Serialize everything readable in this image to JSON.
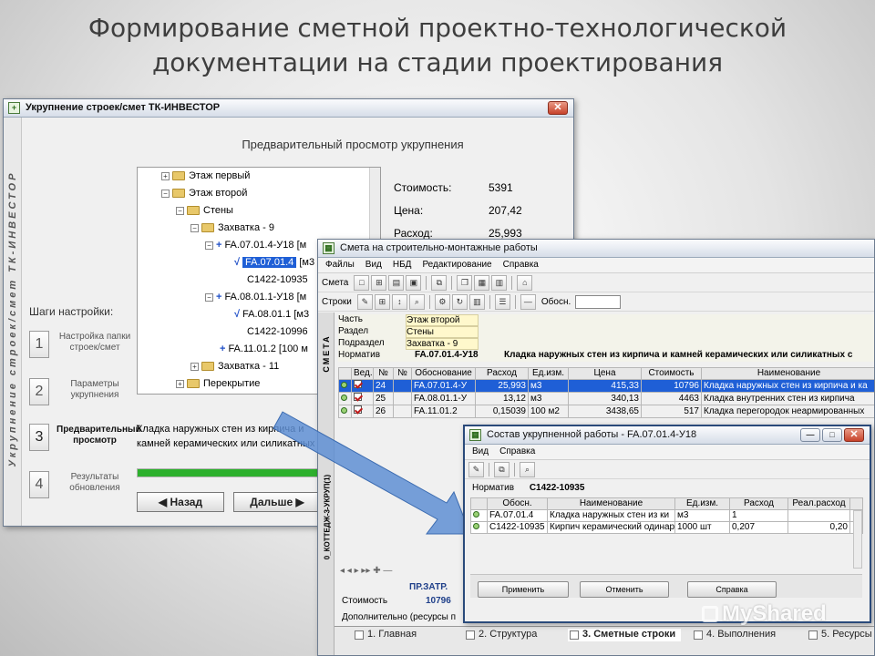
{
  "slide": {
    "title_line1": "Формирование сметной проектно-технологической",
    "title_line2": "документации на стадии проектирования"
  },
  "win1": {
    "title": "Укрупнение строек/смет ТК-ИНВЕСТОР",
    "side_label": "Укрупнение строек/смет ТК-ИНВЕСТОР",
    "header": "Предварительный просмотр укрупнения",
    "tree": [
      {
        "label": "Этаж первый"
      },
      {
        "label": "Этаж второй"
      },
      {
        "label": "Стены"
      },
      {
        "label": "Захватка - 9"
      },
      {
        "label": "FA.07.01.4-У18",
        "suffix": "[м"
      },
      {
        "label": "FA.07.01.4",
        "suffix": "[м3"
      },
      {
        "label": "С1422-10935"
      },
      {
        "label": "FA.08.01.1-У18",
        "suffix": "[м"
      },
      {
        "label": "FA.08.01.1",
        "suffix": "[м3"
      },
      {
        "label": "С1422-10996"
      },
      {
        "label": "FA.11.01.2",
        "suffix": "[100 м"
      },
      {
        "label": "Захватка - 11"
      },
      {
        "label": "Перекрытие"
      }
    ],
    "stats": [
      {
        "label": "Стоимость:",
        "value": "5391"
      },
      {
        "label": "Цена:",
        "value": "207,42"
      },
      {
        "label": "Расход:",
        "value": "25,993"
      }
    ],
    "steps_title": "Шаги настройки:",
    "steps": [
      {
        "num": "1",
        "label": "Настройка папки строек/смет"
      },
      {
        "num": "2",
        "label": "Параметры укрупнения"
      },
      {
        "num": "3",
        "label": "Предварительный просмотр"
      },
      {
        "num": "4",
        "label": "Результаты обновления"
      }
    ],
    "description": "Кладка наружных стен из кирпича и камней керамических или силикатных с лицевым кирпичом, камнями керамическими",
    "progress": 1.0,
    "back_button": "◀  Назад",
    "next_button": "Дальше  ▶"
  },
  "win2": {
    "title": "Смета на строительно-монтажные работы",
    "menu": [
      "Файлы",
      "Вид",
      "НБД",
      "Редактирование",
      "Справка"
    ],
    "toolbar1_label": "Смета",
    "toolbar2_label": "Строки",
    "obosn_label": "Обосн.",
    "side_label": "СМЕТА",
    "side_label2": "0_КОТТЕДЖ-3-УКРУП(1)",
    "info": [
      {
        "label": "Часть",
        "value": "Этаж второй"
      },
      {
        "label": "Раздел",
        "value": "Стены"
      },
      {
        "label": "Подраздел",
        "value": "Захватка - 9"
      }
    ],
    "normativ_label": "Норматив",
    "normativ_code": "FA.07.01.4-У18",
    "normativ_name": "Кладка наружных стен из кирпича и камней керамических или силикатных с",
    "columns": [
      "Вед.",
      "№",
      "№",
      "Обоснование",
      "Расход",
      "Ед.изм.",
      "Цена",
      "Стоимость",
      "Наименование"
    ],
    "rows": [
      {
        "n": "24",
        "code": "FA.07.01.4-У",
        "qty": "25,993",
        "unit": "м3",
        "price": "415,33",
        "cost": "10796",
        "name": "Кладка наружных стен из кирпича и ка"
      },
      {
        "n": "25",
        "code": "FA.08.01.1-У",
        "qty": "13,12",
        "unit": "м3",
        "price": "340,13",
        "cost": "4463",
        "name": "Кладка внутренних стен из кирпича"
      },
      {
        "n": "26",
        "code": "FA.11.01.2",
        "qty": "0,15039",
        "unit": "100 м2",
        "price": "3438,65",
        "cost": "517",
        "name": "Кладка перегородок неармированных"
      }
    ],
    "bottom_header": "ПР.ЗАТР.",
    "cost_label": "Стоимость",
    "cost_value": "10796",
    "extra": "Дополнительно (ресурсы п",
    "tabs": [
      "1. Главная",
      "2. Структура",
      "3. Сметные строки",
      "4. Выполнения",
      "5. Ресурсы"
    ]
  },
  "win3": {
    "title": "Состав укрупненной работы - FA.07.01.4-У18",
    "menu": [
      "Вид",
      "Справка"
    ],
    "normativ_label": "Норматив",
    "normativ_value": "С1422-10935",
    "columns": [
      "Обосн.",
      "Наименование",
      "Ед.изм.",
      "Расход",
      "Реал.расход"
    ],
    "rows": [
      {
        "code": "FA.07.01.4",
        "name": "Кладка наружных стен из ки",
        "unit": "м3",
        "qty": "1",
        "real": ""
      },
      {
        "code": "С1422-10935",
        "name": "Кирпич керамический одинар",
        "unit": "1000 шт",
        "qty": "0,207",
        "real": "0,20"
      }
    ],
    "buttons": [
      "Применить",
      "Отменить",
      "Справка"
    ]
  },
  "watermark": "MyShared",
  "colors": {
    "selection": "#1f5fd6",
    "arrow": "#5f8fd4",
    "progress": "#2db02d"
  }
}
